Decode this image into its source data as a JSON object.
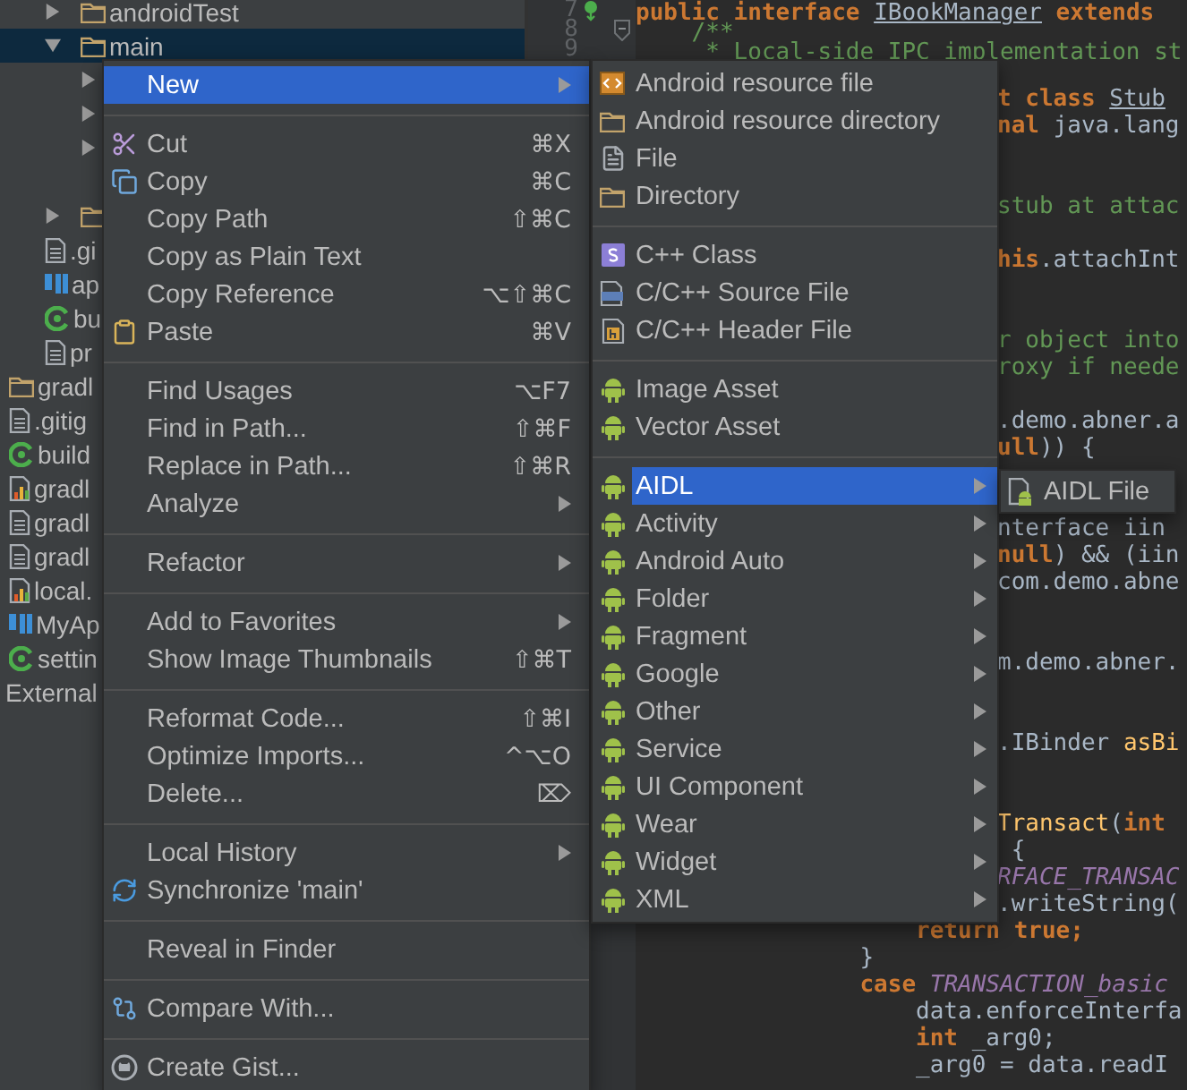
{
  "project_tree": [
    {
      "children": [
        {
          "label": "androidTest",
          "kind": "folder",
          "expanded": false,
          "selected": false
        },
        {
          "label": "main",
          "kind": "folder",
          "expanded": true,
          "selected": true,
          "children": [
            {
              "expanded": false,
              "selected": false
            },
            {
              "expanded": false,
              "selected": false
            },
            {
              "expanded": false,
              "selected": false
            },
            {
              "selected": false
            }
          ]
        },
        {
          "kind": "folder",
          "expanded": false,
          "selected": false
        },
        {
          "label": ".gi",
          "kind": "doc",
          "selected": false
        },
        {
          "label": "ap",
          "kind": "module",
          "selected": false
        },
        {
          "label": "bu",
          "kind": "gradle",
          "selected": false
        },
        {
          "label": "pr",
          "kind": "doc",
          "selected": false
        }
      ]
    },
    {
      "label": "gradl",
      "kind": "folder",
      "selected": false
    },
    {
      "label": ".gitig",
      "kind": "doc",
      "selected": false
    },
    {
      "label": "build",
      "kind": "gradle",
      "selected": false
    },
    {
      "label": "gradl",
      "kind": "props",
      "selected": false
    },
    {
      "label": "gradl",
      "kind": "doc",
      "selected": false
    },
    {
      "label": "gradl",
      "kind": "doc",
      "selected": false
    },
    {
      "label": "local.",
      "kind": "props",
      "selected": false
    },
    {
      "label": "MyAp",
      "kind": "module",
      "selected": false
    },
    {
      "label": "settin",
      "kind": "gradle",
      "selected": false
    },
    {
      "label": "External",
      "kind": "none",
      "selected": false
    }
  ],
  "editor": {
    "gutter": [
      {
        "number": "7",
        "kind": "implemented"
      },
      {
        "number": "8",
        "kind": "fold"
      },
      {
        "number": "9",
        "kind": "plain"
      }
    ],
    "lines": [
      {
        "kind": "top",
        "segments": [
          {
            "text": "public interface ",
            "kind": "keyword"
          },
          {
            "text": "IBookManager",
            "kind": "underlined"
          },
          {
            "text": " extends",
            "kind": "keyword"
          }
        ]
      },
      {
        "kind": "top",
        "segments": [
          {
            "text": "    /**",
            "kind": "doc"
          }
        ]
      },
      {
        "kind": "top",
        "segments": [
          {
            "text": "     * Local-side IPC implementation st",
            "kind": "doc"
          }
        ]
      },
      {
        "kind": "blank"
      },
      {
        "kind": "clipped",
        "segments": [
          {
            "text": "t class ",
            "kind": "keyword"
          },
          {
            "text": "Stub",
            "kind": "underlined"
          }
        ]
      },
      {
        "kind": "clipped",
        "segments": [
          {
            "text": "nal ",
            "kind": "keyword"
          },
          {
            "text": "java.lang",
            "kind": "plain"
          }
        ]
      },
      {
        "kind": "blank"
      },
      {
        "kind": "blank"
      },
      {
        "kind": "clipped",
        "segments": [
          {
            "text": "stub at attac",
            "kind": "doc"
          }
        ]
      },
      {
        "kind": "blank"
      },
      {
        "kind": "clipped",
        "segments": [
          {
            "text": "his",
            "kind": "keyword"
          },
          {
            "text": ".attachInt",
            "kind": "plain"
          }
        ]
      },
      {
        "kind": "blank"
      },
      {
        "kind": "blank"
      },
      {
        "kind": "clipped",
        "segments": [
          {
            "text": "r object into",
            "kind": "doc"
          }
        ]
      },
      {
        "kind": "clipped",
        "segments": [
          {
            "text": "roxy if neede",
            "kind": "doc"
          }
        ]
      },
      {
        "kind": "blank"
      },
      {
        "kind": "clipped",
        "segments": [
          {
            "text": ".demo.abner.a",
            "kind": "plain"
          }
        ]
      },
      {
        "kind": "clipped",
        "segments": [
          {
            "text": "ull",
            "kind": "keyword"
          },
          {
            "text": ")) {",
            "kind": "plain"
          }
        ]
      },
      {
        "kind": "blank"
      },
      {
        "kind": "blank"
      },
      {
        "kind": "clipped",
        "segments": [
          {
            "text": "nterface iin",
            "kind": "plain"
          }
        ]
      },
      {
        "kind": "clipped",
        "segments": [
          {
            "text": "null",
            "kind": "keyword"
          },
          {
            "text": ") && (iin",
            "kind": "plain"
          }
        ]
      },
      {
        "kind": "clipped",
        "segments": [
          {
            "text": "com.demo.abne",
            "kind": "plain"
          }
        ]
      },
      {
        "kind": "blank"
      },
      {
        "kind": "blank"
      },
      {
        "kind": "clipped",
        "segments": [
          {
            "text": "m.demo.abner.",
            "kind": "plain"
          }
        ]
      },
      {
        "kind": "blank"
      },
      {
        "kind": "blank"
      },
      {
        "kind": "clipped",
        "segments": [
          {
            "text": ".IBinder ",
            "kind": "plain"
          },
          {
            "text": "asBi",
            "kind": "method"
          }
        ]
      },
      {
        "kind": "blank"
      },
      {
        "kind": "blank"
      },
      {
        "kind": "clipped",
        "segments": [
          {
            "text": "Transact",
            "kind": "method"
          },
          {
            "text": "(",
            "kind": "plain"
          },
          {
            "text": "int",
            "kind": "keyword"
          }
        ]
      },
      {
        "kind": "clipped",
        "segments": [
          {
            "text": " {",
            "kind": "plain"
          }
        ]
      },
      {
        "kind": "clipped",
        "segments": [
          {
            "text": "RFACE_TRANSAC",
            "kind": "constant"
          }
        ]
      },
      {
        "kind": "clipped",
        "segments": [
          {
            "text": ".writeString(",
            "kind": "plain"
          }
        ]
      },
      {
        "kind": "full",
        "segments": [
          {
            "text": "                    return true;",
            "kind": "keyword"
          }
        ]
      },
      {
        "kind": "full",
        "segments": [
          {
            "text": "                }",
            "kind": "plain"
          }
        ]
      },
      {
        "kind": "full",
        "segments": [
          {
            "text": "                case ",
            "kind": "keyword"
          },
          {
            "text": "TRANSACTION_basic",
            "kind": "constant"
          }
        ]
      },
      {
        "kind": "full",
        "segments": [
          {
            "text": "                    data.enforceInterfa",
            "kind": "plain"
          }
        ]
      },
      {
        "kind": "full",
        "segments": [
          {
            "text": "                    int",
            "kind": "keyword"
          },
          {
            "text": " _arg0;",
            "kind": "plain"
          }
        ]
      },
      {
        "kind": "full",
        "segments": [
          {
            "text": "                    _arg0 = data.readI",
            "kind": "plain"
          }
        ]
      }
    ]
  },
  "context_menu": {
    "items": [
      {
        "kind": "plain",
        "label": "New",
        "submenu": true,
        "selected": true
      },
      {
        "kind": "separator"
      },
      {
        "kind": "cut",
        "label": "Cut",
        "shortcut": "⌘X",
        "submenu": false,
        "selected": false
      },
      {
        "kind": "copy",
        "label": "Copy",
        "shortcut": "⌘C",
        "submenu": false,
        "selected": false
      },
      {
        "kind": "plain",
        "label": "Copy Path",
        "shortcut": "⇧⌘C",
        "submenu": false,
        "selected": false
      },
      {
        "kind": "plain",
        "label": "Copy as Plain Text",
        "submenu": false,
        "selected": false
      },
      {
        "kind": "plain",
        "label": "Copy Reference",
        "shortcut": "⌥⇧⌘C",
        "submenu": false,
        "selected": false
      },
      {
        "kind": "paste",
        "label": "Paste",
        "shortcut": "⌘V",
        "submenu": false,
        "selected": false
      },
      {
        "kind": "separator"
      },
      {
        "kind": "plain",
        "label": "Find Usages",
        "shortcut": "⌥F7",
        "submenu": false,
        "selected": false
      },
      {
        "kind": "plain",
        "label": "Find in Path...",
        "shortcut": "⇧⌘F",
        "submenu": false,
        "selected": false
      },
      {
        "kind": "plain",
        "label": "Replace in Path...",
        "shortcut": "⇧⌘R",
        "submenu": false,
        "selected": false
      },
      {
        "kind": "plain",
        "label": "Analyze",
        "submenu": true,
        "selected": false
      },
      {
        "kind": "separator"
      },
      {
        "kind": "plain",
        "label": "Refactor",
        "submenu": true,
        "selected": false
      },
      {
        "kind": "separator"
      },
      {
        "kind": "plain",
        "label": "Add to Favorites",
        "submenu": true,
        "selected": false
      },
      {
        "kind": "plain",
        "label": "Show Image Thumbnails",
        "shortcut": "⇧⌘T",
        "submenu": false,
        "selected": false
      },
      {
        "kind": "separator"
      },
      {
        "kind": "plain",
        "label": "Reformat Code...",
        "shortcut": "⇧⌘I",
        "submenu": false,
        "selected": false
      },
      {
        "kind": "plain",
        "label": "Optimize Imports...",
        "shortcut": "^⌥O",
        "submenu": false,
        "selected": false
      },
      {
        "kind": "plain",
        "label": "Delete...",
        "shortcut": "⌦",
        "submenu": false,
        "selected": false
      },
      {
        "kind": "separator"
      },
      {
        "kind": "plain",
        "label": "Local History",
        "submenu": true,
        "selected": false
      },
      {
        "kind": "sync",
        "label": "Synchronize 'main'",
        "submenu": false,
        "selected": false
      },
      {
        "kind": "separator"
      },
      {
        "kind": "plain",
        "label": "Reveal in Finder",
        "submenu": false,
        "selected": false
      },
      {
        "kind": "separator"
      },
      {
        "kind": "compare",
        "label": "Compare With...",
        "submenu": false,
        "selected": false
      },
      {
        "kind": "separator"
      },
      {
        "kind": "gist",
        "label": "Create Gist...",
        "submenu": false,
        "selected": false
      }
    ]
  },
  "new_submenu": {
    "items": [
      {
        "kind": "resource",
        "label": "Android resource file",
        "submenu": false,
        "selected": false
      },
      {
        "kind": "folder",
        "label": "Android resource directory",
        "submenu": false,
        "selected": false
      },
      {
        "kind": "file",
        "label": "File",
        "submenu": false,
        "selected": false
      },
      {
        "kind": "folder",
        "label": "Directory",
        "submenu": false,
        "selected": false
      },
      {
        "kind": "separator"
      },
      {
        "kind": "cpp_class",
        "label": "C++ Class",
        "submenu": false,
        "selected": false
      },
      {
        "kind": "cpp_source",
        "label": "C/C++ Source File",
        "submenu": false,
        "selected": false
      },
      {
        "kind": "cpp_header",
        "label": "C/C++ Header File",
        "submenu": false,
        "selected": false
      },
      {
        "kind": "separator"
      },
      {
        "kind": "android",
        "label": "Image Asset",
        "submenu": false,
        "selected": false
      },
      {
        "kind": "android",
        "label": "Vector Asset",
        "submenu": false,
        "selected": false
      },
      {
        "kind": "separator"
      },
      {
        "kind": "android",
        "label": "AIDL",
        "submenu": true,
        "selected": true
      },
      {
        "kind": "android",
        "label": "Activity",
        "submenu": true,
        "selected": false
      },
      {
        "kind": "android",
        "label": "Android Auto",
        "submenu": true,
        "selected": false
      },
      {
        "kind": "android",
        "label": "Folder",
        "submenu": true,
        "selected": false
      },
      {
        "kind": "android",
        "label": "Fragment",
        "submenu": true,
        "selected": false
      },
      {
        "kind": "android",
        "label": "Google",
        "submenu": true,
        "selected": false
      },
      {
        "kind": "android",
        "label": "Other",
        "submenu": true,
        "selected": false
      },
      {
        "kind": "android",
        "label": "Service",
        "submenu": true,
        "selected": false
      },
      {
        "kind": "android",
        "label": "UI Component",
        "submenu": true,
        "selected": false
      },
      {
        "kind": "android",
        "label": "Wear",
        "submenu": true,
        "selected": false
      },
      {
        "kind": "android",
        "label": "Widget",
        "submenu": true,
        "selected": false
      },
      {
        "kind": "android",
        "label": "XML",
        "submenu": true,
        "selected": false
      }
    ]
  },
  "aidl_submenu": {
    "items": [
      {
        "kind": "aidl",
        "label": "AIDL File",
        "submenu": false,
        "selected": false
      }
    ]
  }
}
